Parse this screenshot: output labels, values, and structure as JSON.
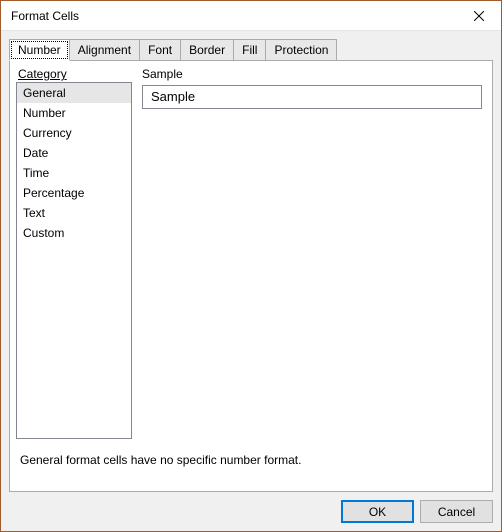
{
  "window": {
    "title": "Format Cells"
  },
  "tabs": [
    {
      "label": "Number",
      "active": true
    },
    {
      "label": "Alignment"
    },
    {
      "label": "Font"
    },
    {
      "label": "Border"
    },
    {
      "label": "Fill"
    },
    {
      "label": "Protection"
    }
  ],
  "category": {
    "label": "Category",
    "items": [
      {
        "label": "General",
        "selected": true
      },
      {
        "label": "Number"
      },
      {
        "label": "Currency"
      },
      {
        "label": "Date"
      },
      {
        "label": "Time"
      },
      {
        "label": "Percentage"
      },
      {
        "label": "Text"
      },
      {
        "label": "Custom"
      }
    ]
  },
  "sample": {
    "label": "Sample",
    "value": "Sample"
  },
  "description": "General format cells have no specific number format.",
  "buttons": {
    "ok": "OK",
    "cancel": "Cancel"
  }
}
